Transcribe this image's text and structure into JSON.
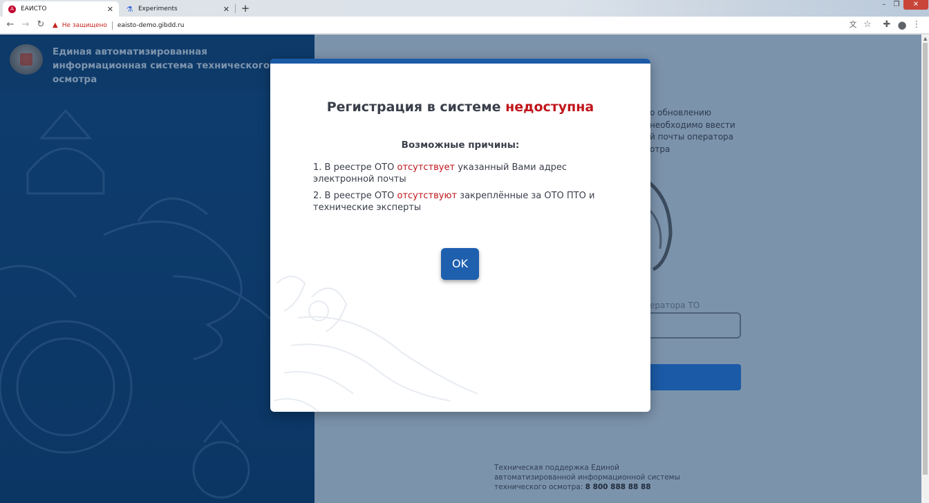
{
  "browser": {
    "tabs": [
      {
        "title": "ЕАИСТО",
        "icon": "angular-icon",
        "active": true
      },
      {
        "title": "Experiments",
        "icon": "flask-icon",
        "active": false
      }
    ],
    "not_secure_label": "Не защищено",
    "url": "eaisto-demo.gibdd.ru"
  },
  "header": {
    "system_title": "Единая автоматизированная информационная система технического осмотра"
  },
  "background_form": {
    "intro_line1": "о обновлению",
    "intro_line2": "необходимо ввести",
    "intro_line3": "й почты оператора",
    "intro_line4": "отра",
    "email_label": "ератора ТО",
    "support_text": "Техническая поддержка Единой автоматизированной информационной системы технического осмотра:",
    "support_phone": "8 800 888 88 88"
  },
  "modal": {
    "title_prefix": "Регистрация в системе",
    "title_accent": "недоступна",
    "reasons_heading": "Возможные причины:",
    "reasons": [
      {
        "prefix": "1. В реестре ОТО",
        "accent": "отсутствует",
        "suffix": "указанный Вами адрес электронной почты"
      },
      {
        "prefix": "2. В реестре ОТО",
        "accent": "отсутствуют",
        "suffix": "закреплённые за ОТО ПТО и технические эксперты"
      }
    ],
    "ok_label": "OK"
  },
  "colors": {
    "accent_red": "#c0151a",
    "primary_blue": "#1e5fae",
    "left_panel": "#0d3a69"
  }
}
